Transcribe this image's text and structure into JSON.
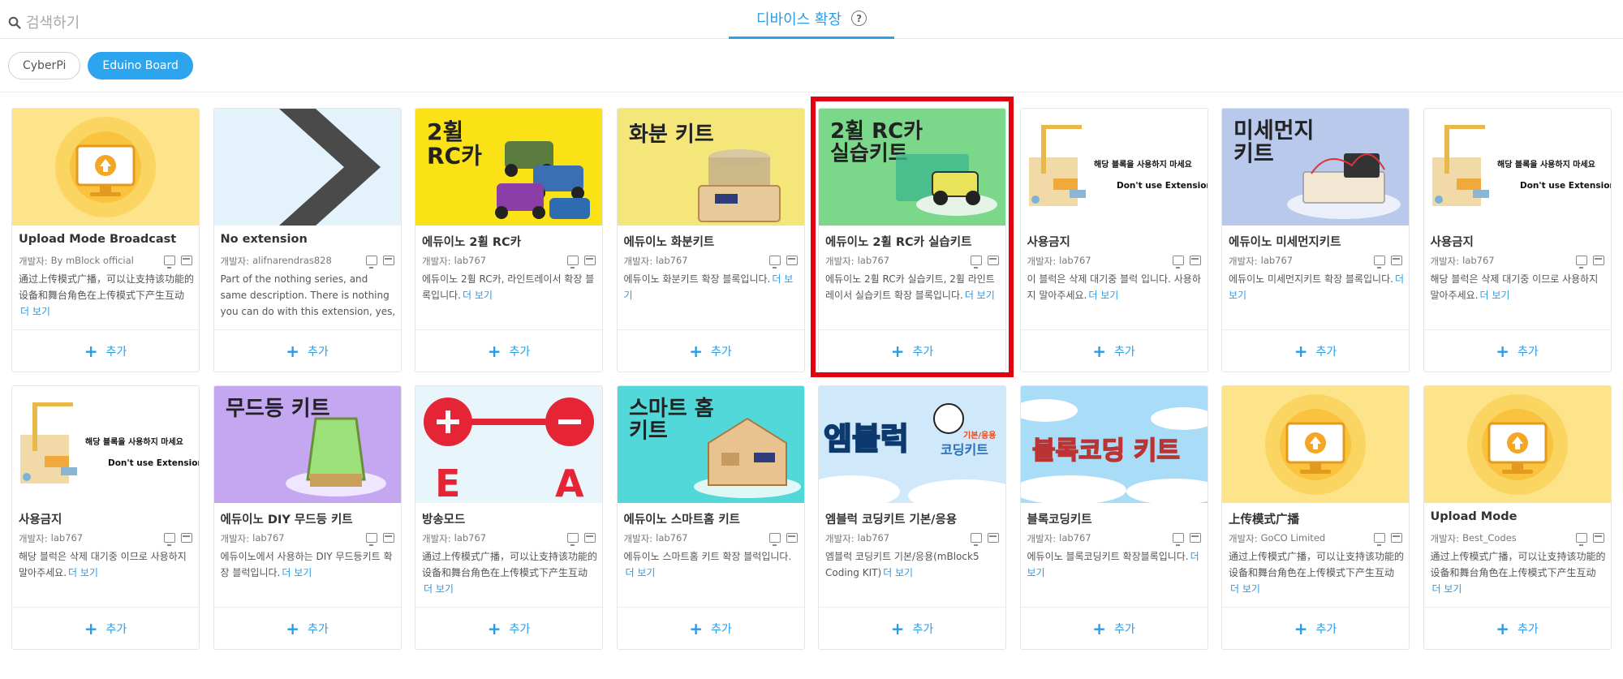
{
  "search": {
    "placeholder": "검색하기"
  },
  "header": {
    "title": "디바이스 확장"
  },
  "filters": [
    "CyberPi",
    "Eduino Board"
  ],
  "card_labels": {
    "developer_prefix": "개발자:",
    "more": "더 보기",
    "add": "추가"
  },
  "cards": [
    {
      "name": "Upload Mode Broadcast",
      "developer": "By mBlock official",
      "desc": "通过上传模式广播，可以让支持该功能的设备和舞台角色在上传模式下产生互动",
      "thumb": "upload-yellow-icon"
    },
    {
      "name": "No extension",
      "developer": "alifnarendras828",
      "desc": "Part of the nothing series, and same description. There is nothing you can do with this extension, yes, nothing,...",
      "thumb": "chevron-grey-icon"
    },
    {
      "name": "에듀이노 2휠 RC카",
      "developer": "lab767",
      "desc": "에듀이노 2휠 RC카, 라인트레이서 확장 블록입니다.",
      "thumb": "rc-cars-photo",
      "label": "2휠\nRC카"
    },
    {
      "name": "에듀이노 화분키트",
      "developer": "lab767",
      "desc": "에듀이노 화분키트 확장 블록입니다.",
      "thumb": "flowerpot-kit-photo",
      "label": "화분 키트"
    },
    {
      "name": "에듀이노 2휠 RC카 실습키트",
      "developer": "lab767",
      "desc": "에듀이노 2휠 RC카 실습키트, 2휠 라인트레이서 실습키트 확장 블록입니다.",
      "thumb": "rc-kit-green-photo",
      "label": "2휠 RC카\n실습키트",
      "highlighted": true
    },
    {
      "name": "사용금지",
      "developer": "lab767",
      "desc": "이 블럭은 삭제 대기중 블럭 입니다. 사용하지 말아주세요.",
      "thumb": "construction-illustration",
      "overlay1": "해당 블록을 사용하지 마세요",
      "overlay2": "Don't use Extension"
    },
    {
      "name": "에듀이노 미세먼지키트",
      "developer": "lab767",
      "desc": "에듀이노 미세먼지키트 확장 블록입니다.",
      "thumb": "dust-kit-photo",
      "label": "미세먼지\n키트"
    },
    {
      "name": "사용금지",
      "developer": "lab767",
      "desc": "해당 블럭은 삭제 대기중 이므로 사용하지 말아주세요.",
      "thumb": "construction-illustration",
      "overlay1": "해당 블록을 사용하지 마세요",
      "overlay2": "Don't use Extension"
    },
    {
      "name": "사용금지",
      "developer": "lab767",
      "desc": "해당 블럭은 삭제 대기중 이므로 사용하지 말아주세요.",
      "thumb": "construction-illustration",
      "overlay1": "해당 블록을 사용하지 마세요",
      "overlay2": "Don't use Extension"
    },
    {
      "name": "에듀이노 DIY 무드등 키트",
      "developer": "lab767",
      "desc": "에듀이노에서 사용하는 DIY 무드등키트 확장 블럭입니다.",
      "thumb": "mood-lamp-photo",
      "label": "무드등 키트"
    },
    {
      "name": "방송모드",
      "developer": "lab767",
      "desc": "通过上传模式广播，可以让支持该功能的设备和舞台角色在上传模式下产生互动",
      "thumb": "broadcast-ea-icon",
      "lettersA": "E",
      "lettersB": "A"
    },
    {
      "name": "에듀이노 스마트홈 키트",
      "developer": "lab767",
      "desc": "에듀이노 스마트홈 키트 확장 블럭입니다.",
      "thumb": "smarthome-photo",
      "label": "스마트 홈\n키트"
    },
    {
      "name": "엠블럭 코딩키트 기본/응용",
      "developer": "lab767",
      "desc": "엠블럭 코딩키트 기본/응용(mBlock5 Coding KIT)",
      "thumb": "mblock-kit-banner",
      "banner": "엠블럭",
      "banner_sub": "기본/응용",
      "banner_sub2": "코딩키트"
    },
    {
      "name": "블록코딩키트",
      "developer": "lab767",
      "desc": "에듀이노 블록코딩키트 확장블록입니다.",
      "thumb": "block-coding-banner",
      "banner": "블록코딩 키트"
    },
    {
      "name": "上传模式广播",
      "developer": "GoCO Limited",
      "desc": "通过上传模式广播，可以让支持该功能的设备和舞台角色在上传模式下产生互动",
      "thumb": "upload-yellow-icon"
    },
    {
      "name": "Upload Mode",
      "developer": "Best_Codes",
      "desc": "通过上传模式广播，可以让支持该功能的设备和舞台角色在上传模式下产生互动",
      "thumb": "upload-yellow-icon"
    }
  ]
}
